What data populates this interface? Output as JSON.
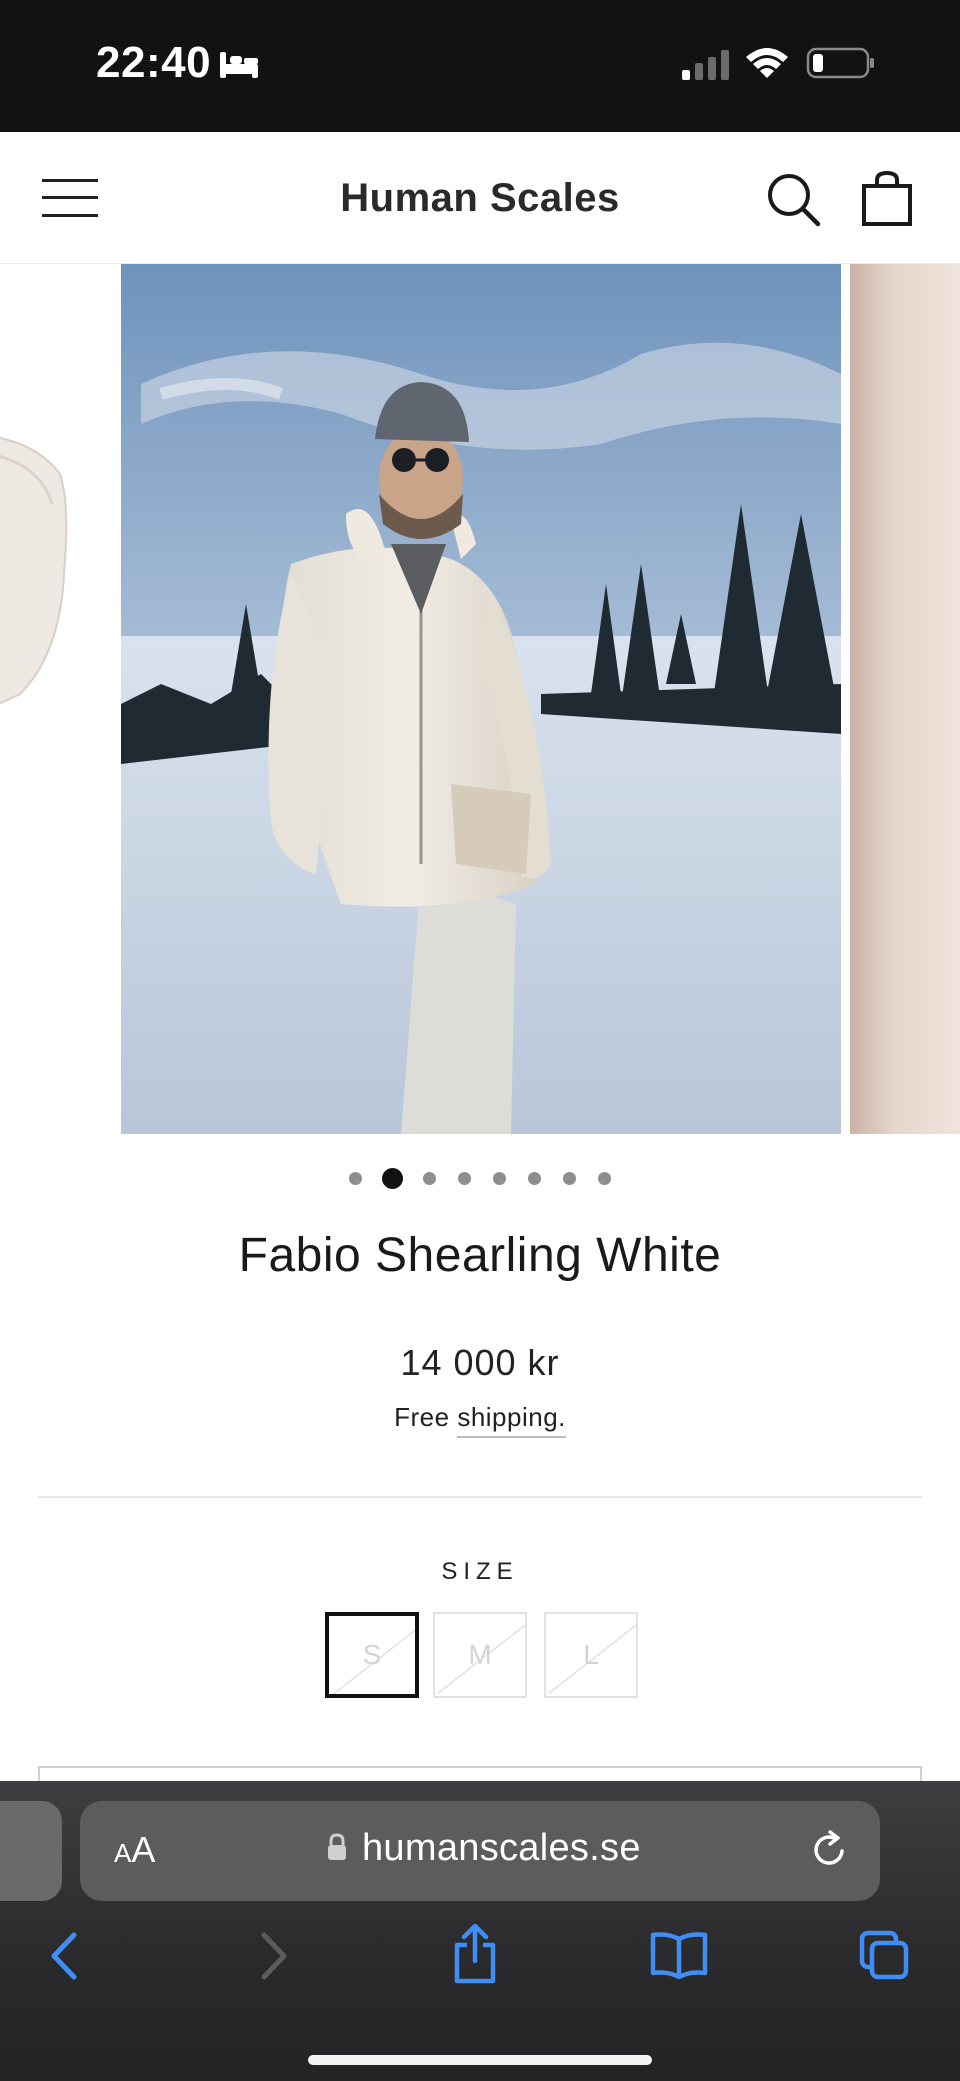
{
  "status_bar": {
    "time": "22:40",
    "icons": [
      "bed-icon",
      "signal-icon",
      "wifi-icon",
      "battery-icon"
    ]
  },
  "header": {
    "title": "Human Scales",
    "icons": [
      "menu-icon",
      "search-icon",
      "cart-icon"
    ]
  },
  "carousel": {
    "slide_count": 8,
    "active_index": 1,
    "main_image": "man-in-white-shearling-jacket-in-snow"
  },
  "product": {
    "title": "Fabio Shearling White",
    "price": "14 000 kr",
    "shipping_prefix": "Free",
    "shipping_link": "shipping.",
    "size_label": "SIZE",
    "sizes": [
      "S",
      "M",
      "L"
    ],
    "selected_size": "S"
  },
  "browser": {
    "aa_small": "A",
    "aa_large": "A",
    "url": "humanscales.se"
  },
  "colors": {
    "status_bar": "#121212",
    "browser_bar": "#2a2a2c",
    "browser_accent": "#3f8ef5"
  }
}
